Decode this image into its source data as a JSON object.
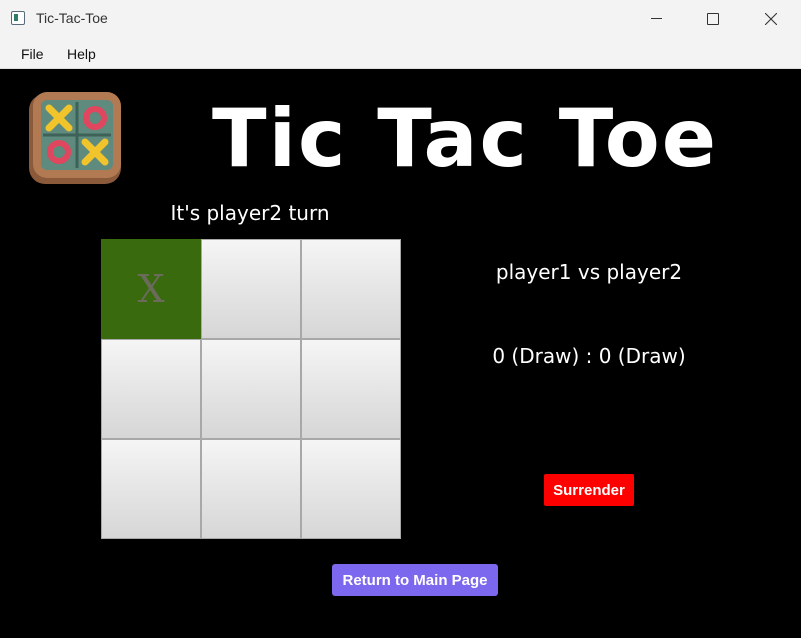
{
  "window": {
    "title": "Tic-Tac-Toe"
  },
  "menu": {
    "file": "File",
    "help": "Help"
  },
  "header": {
    "title": "Tic Tac Toe"
  },
  "game": {
    "turn_text": "It's player2 turn",
    "board": [
      "X",
      "",
      "",
      "",
      "",
      "",
      "",
      "",
      ""
    ],
    "highlighted_cell": 0,
    "highlight_color": "#3a6a0e"
  },
  "score": {
    "matchup": "player1 vs player2",
    "tally": "0 (Draw) : 0 (Draw)"
  },
  "buttons": {
    "surrender": "Surrender",
    "surrender_color": "#ff0000",
    "return": "Return to Main Page",
    "return_color": "#7b68ee"
  }
}
